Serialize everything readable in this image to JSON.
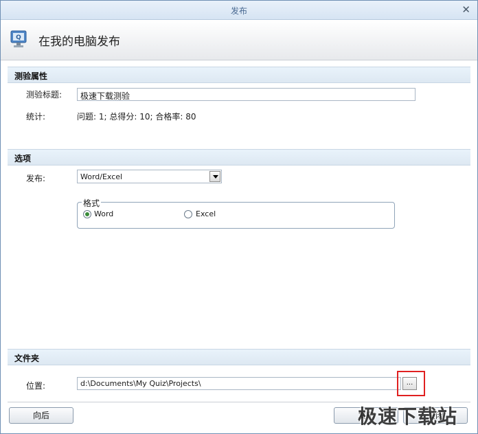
{
  "window": {
    "title": "发布"
  },
  "header": {
    "title": "在我的电脑发布",
    "icon": "quiz-publish-computer-icon"
  },
  "sections": {
    "properties": {
      "title": "测验属性",
      "quiz_title_label": "测验标题:",
      "quiz_title_value": "极速下载测验",
      "stats_label": "统计:",
      "stats_value": "问题: 1;  总得分: 10;  合格率: 80"
    },
    "options": {
      "title": "选项",
      "publish_label": "发布:",
      "publish_value": "Word/Excel",
      "format": {
        "legend": "格式",
        "word_label": "Word",
        "excel_label": "Excel",
        "selected": "Word"
      }
    },
    "folder": {
      "title": "文件夹",
      "location_label": "位置:",
      "location_value": "d:\\Documents\\My Quiz\\Projects\\",
      "browse_label": "..."
    }
  },
  "footer": {
    "back_label": "向后",
    "publish_label": "发布",
    "close_label": "关闭"
  },
  "watermark": "极速下载站",
  "colors": {
    "highlight": "#e02020",
    "accent": "#3a8b3a"
  }
}
